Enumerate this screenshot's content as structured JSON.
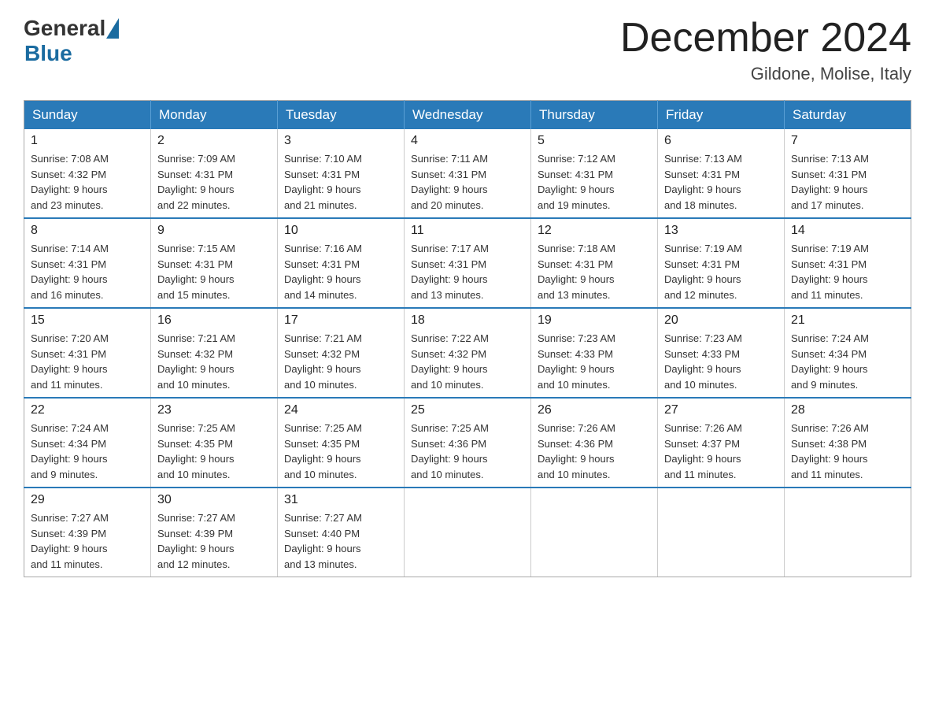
{
  "header": {
    "logo_general": "General",
    "logo_blue": "Blue",
    "month_title": "December 2024",
    "location": "Gildone, Molise, Italy"
  },
  "weekdays": [
    "Sunday",
    "Monday",
    "Tuesday",
    "Wednesday",
    "Thursday",
    "Friday",
    "Saturday"
  ],
  "weeks": [
    [
      {
        "day": "1",
        "sunrise": "7:08 AM",
        "sunset": "4:32 PM",
        "daylight": "9 hours and 23 minutes."
      },
      {
        "day": "2",
        "sunrise": "7:09 AM",
        "sunset": "4:31 PM",
        "daylight": "9 hours and 22 minutes."
      },
      {
        "day": "3",
        "sunrise": "7:10 AM",
        "sunset": "4:31 PM",
        "daylight": "9 hours and 21 minutes."
      },
      {
        "day": "4",
        "sunrise": "7:11 AM",
        "sunset": "4:31 PM",
        "daylight": "9 hours and 20 minutes."
      },
      {
        "day": "5",
        "sunrise": "7:12 AM",
        "sunset": "4:31 PM",
        "daylight": "9 hours and 19 minutes."
      },
      {
        "day": "6",
        "sunrise": "7:13 AM",
        "sunset": "4:31 PM",
        "daylight": "9 hours and 18 minutes."
      },
      {
        "day": "7",
        "sunrise": "7:13 AM",
        "sunset": "4:31 PM",
        "daylight": "9 hours and 17 minutes."
      }
    ],
    [
      {
        "day": "8",
        "sunrise": "7:14 AM",
        "sunset": "4:31 PM",
        "daylight": "9 hours and 16 minutes."
      },
      {
        "day": "9",
        "sunrise": "7:15 AM",
        "sunset": "4:31 PM",
        "daylight": "9 hours and 15 minutes."
      },
      {
        "day": "10",
        "sunrise": "7:16 AM",
        "sunset": "4:31 PM",
        "daylight": "9 hours and 14 minutes."
      },
      {
        "day": "11",
        "sunrise": "7:17 AM",
        "sunset": "4:31 PM",
        "daylight": "9 hours and 13 minutes."
      },
      {
        "day": "12",
        "sunrise": "7:18 AM",
        "sunset": "4:31 PM",
        "daylight": "9 hours and 13 minutes."
      },
      {
        "day": "13",
        "sunrise": "7:19 AM",
        "sunset": "4:31 PM",
        "daylight": "9 hours and 12 minutes."
      },
      {
        "day": "14",
        "sunrise": "7:19 AM",
        "sunset": "4:31 PM",
        "daylight": "9 hours and 11 minutes."
      }
    ],
    [
      {
        "day": "15",
        "sunrise": "7:20 AM",
        "sunset": "4:31 PM",
        "daylight": "9 hours and 11 minutes."
      },
      {
        "day": "16",
        "sunrise": "7:21 AM",
        "sunset": "4:32 PM",
        "daylight": "9 hours and 10 minutes."
      },
      {
        "day": "17",
        "sunrise": "7:21 AM",
        "sunset": "4:32 PM",
        "daylight": "9 hours and 10 minutes."
      },
      {
        "day": "18",
        "sunrise": "7:22 AM",
        "sunset": "4:32 PM",
        "daylight": "9 hours and 10 minutes."
      },
      {
        "day": "19",
        "sunrise": "7:23 AM",
        "sunset": "4:33 PM",
        "daylight": "9 hours and 10 minutes."
      },
      {
        "day": "20",
        "sunrise": "7:23 AM",
        "sunset": "4:33 PM",
        "daylight": "9 hours and 10 minutes."
      },
      {
        "day": "21",
        "sunrise": "7:24 AM",
        "sunset": "4:34 PM",
        "daylight": "9 hours and 9 minutes."
      }
    ],
    [
      {
        "day": "22",
        "sunrise": "7:24 AM",
        "sunset": "4:34 PM",
        "daylight": "9 hours and 9 minutes."
      },
      {
        "day": "23",
        "sunrise": "7:25 AM",
        "sunset": "4:35 PM",
        "daylight": "9 hours and 10 minutes."
      },
      {
        "day": "24",
        "sunrise": "7:25 AM",
        "sunset": "4:35 PM",
        "daylight": "9 hours and 10 minutes."
      },
      {
        "day": "25",
        "sunrise": "7:25 AM",
        "sunset": "4:36 PM",
        "daylight": "9 hours and 10 minutes."
      },
      {
        "day": "26",
        "sunrise": "7:26 AM",
        "sunset": "4:36 PM",
        "daylight": "9 hours and 10 minutes."
      },
      {
        "day": "27",
        "sunrise": "7:26 AM",
        "sunset": "4:37 PM",
        "daylight": "9 hours and 11 minutes."
      },
      {
        "day": "28",
        "sunrise": "7:26 AM",
        "sunset": "4:38 PM",
        "daylight": "9 hours and 11 minutes."
      }
    ],
    [
      {
        "day": "29",
        "sunrise": "7:27 AM",
        "sunset": "4:39 PM",
        "daylight": "9 hours and 11 minutes."
      },
      {
        "day": "30",
        "sunrise": "7:27 AM",
        "sunset": "4:39 PM",
        "daylight": "9 hours and 12 minutes."
      },
      {
        "day": "31",
        "sunrise": "7:27 AM",
        "sunset": "4:40 PM",
        "daylight": "9 hours and 13 minutes."
      },
      null,
      null,
      null,
      null
    ]
  ],
  "labels": {
    "sunrise": "Sunrise:",
    "sunset": "Sunset:",
    "daylight": "Daylight:"
  }
}
